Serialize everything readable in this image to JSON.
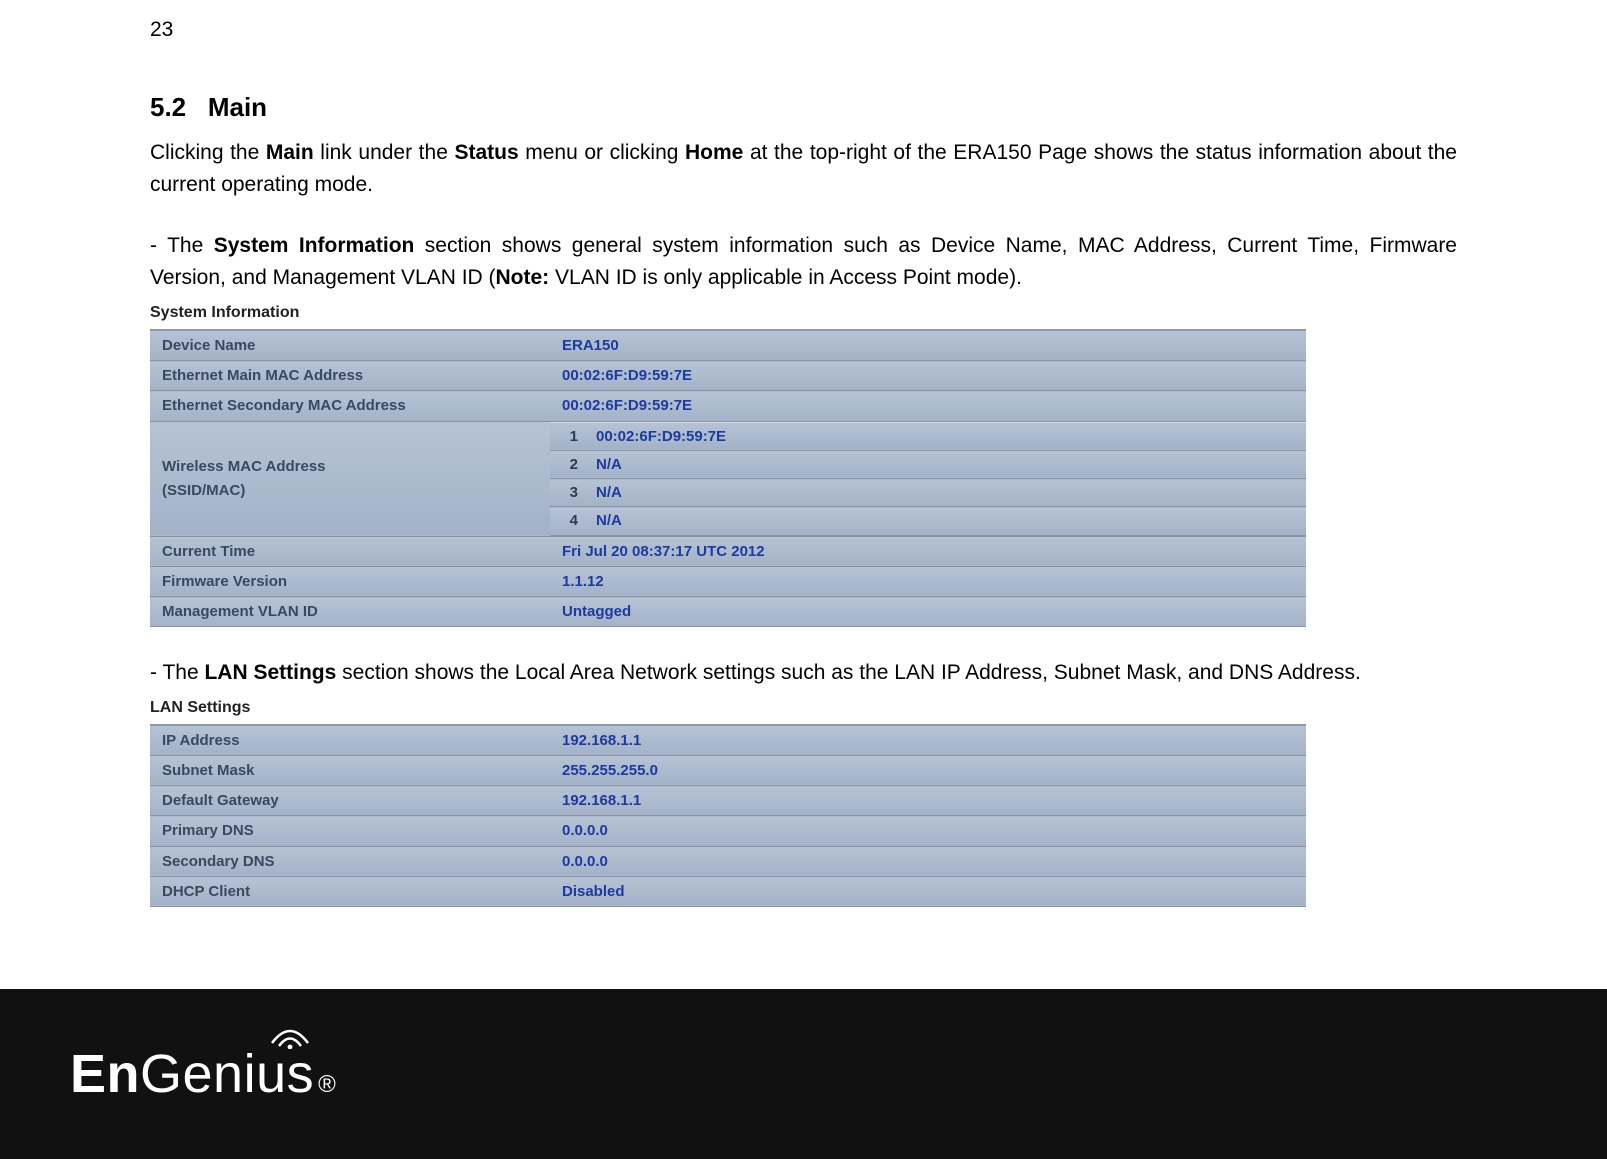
{
  "page_number": "23",
  "section": {
    "number": "5.2",
    "title": "Main"
  },
  "intro_parts": {
    "p1a": "Clicking the ",
    "p1b": "Main",
    "p1c": " link under the ",
    "p1d": "Status",
    "p1e": " menu or clicking ",
    "p1f": "Home",
    "p1g": " at the top-right of the ERA150 Page shows the status information about the current operating mode."
  },
  "sysinfo_parts": {
    "a": "- The ",
    "b": "System Information",
    "c": " section shows general system information such as Device Name, MAC Address, Current Time, Firmware Version, and Management VLAN ID (",
    "d": "Note:",
    "e": " VLAN ID is only applicable in Access Point mode)."
  },
  "lan_parts": {
    "a": "- The ",
    "b": "LAN Settings",
    "c": " section shows the Local Area Network settings such as the LAN IP Address, Subnet Mask, and DNS Address."
  },
  "tables": {
    "sysinfo": {
      "caption": "System Information",
      "rows": {
        "device_name": {
          "label": "Device Name",
          "value": "ERA150"
        },
        "eth_main": {
          "label": "Ethernet Main MAC Address",
          "value": "00:02:6F:D9:59:7E"
        },
        "eth_sec": {
          "label": "Ethernet Secondary MAC Address",
          "value": "00:02:6F:D9:59:7E"
        },
        "wireless": {
          "label_line1": "Wireless MAC Address",
          "label_line2": "(SSID/MAC)",
          "list": [
            {
              "idx": "1",
              "mac": "00:02:6F:D9:59:7E"
            },
            {
              "idx": "2",
              "mac": "N/A"
            },
            {
              "idx": "3",
              "mac": "N/A"
            },
            {
              "idx": "4",
              "mac": "N/A"
            }
          ]
        },
        "current_time": {
          "label": "Current Time",
          "value": "Fri Jul 20 08:37:17 UTC 2012"
        },
        "firmware": {
          "label": "Firmware Version",
          "value": "1.1.12"
        },
        "vlan": {
          "label": "Management VLAN ID",
          "value": "Untagged"
        }
      }
    },
    "lan": {
      "caption": "LAN Settings",
      "rows": {
        "ip": {
          "label": "IP Address",
          "value": "192.168.1.1"
        },
        "mask": {
          "label": "Subnet Mask",
          "value": "255.255.255.0"
        },
        "gw": {
          "label": "Default Gateway",
          "value": "192.168.1.1"
        },
        "pdns": {
          "label": "Primary DNS",
          "value": "0.0.0.0"
        },
        "sdns": {
          "label": "Secondary DNS",
          "value": "0.0.0.0"
        },
        "dhcp": {
          "label": "DHCP Client",
          "value": "Disabled"
        }
      }
    }
  },
  "footer": {
    "brand": "EnGenius",
    "registered": "®"
  }
}
